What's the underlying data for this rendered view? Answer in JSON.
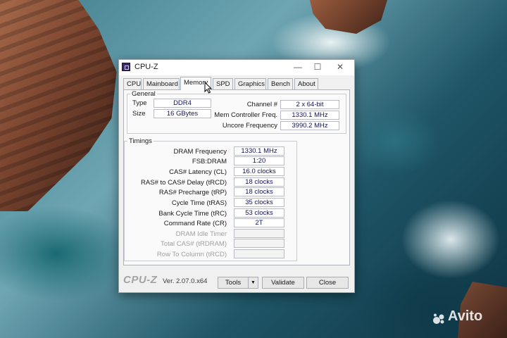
{
  "window": {
    "title": "CPU-Z",
    "controls": {
      "minimize": "—",
      "maximize": "☐",
      "close": "✕"
    }
  },
  "tabs": [
    "CPU",
    "Mainboard",
    "Memory",
    "SPD",
    "Graphics",
    "Bench",
    "About"
  ],
  "active_tab": "Memory",
  "general": {
    "legend": "General",
    "type_label": "Type",
    "type_value": "DDR4",
    "size_label": "Size",
    "size_value": "16 GBytes",
    "channel_label": "Channel #",
    "channel_value": "2 x 64-bit",
    "mem_ctrl_label": "Mem Controller Freq.",
    "mem_ctrl_value": "1330.1 MHz",
    "uncore_label": "Uncore Frequency",
    "uncore_value": "3990.2 MHz"
  },
  "timings": {
    "legend": "Timings",
    "rows": [
      {
        "label": "DRAM Frequency",
        "value": "1330.1 MHz"
      },
      {
        "label": "FSB:DRAM",
        "value": "1:20"
      },
      {
        "label": "CAS# Latency (CL)",
        "value": "16.0 clocks"
      },
      {
        "label": "RAS# to CAS# Delay (tRCD)",
        "value": "18 clocks"
      },
      {
        "label": "RAS# Precharge (tRP)",
        "value": "18 clocks"
      },
      {
        "label": "Cycle Time (tRAS)",
        "value": "35 clocks"
      },
      {
        "label": "Bank Cycle Time (tRC)",
        "value": "53 clocks"
      },
      {
        "label": "Command Rate (CR)",
        "value": "2T"
      },
      {
        "label": "DRAM Idle Timer",
        "value": ""
      },
      {
        "label": "Total CAS# (tRDRAM)",
        "value": ""
      },
      {
        "label": "Row To Column (tRCD)",
        "value": ""
      }
    ]
  },
  "footer": {
    "brand": "CPU-Z",
    "version": "Ver. 2.07.0.x64",
    "tools_label": "Tools",
    "validate_label": "Validate",
    "close_label": "Close"
  },
  "watermark": {
    "text": "Avito"
  },
  "colors": {
    "value_text": "#12125e",
    "window_bg": "#f0f0f0",
    "brand_gray": "#a3a3a3"
  }
}
